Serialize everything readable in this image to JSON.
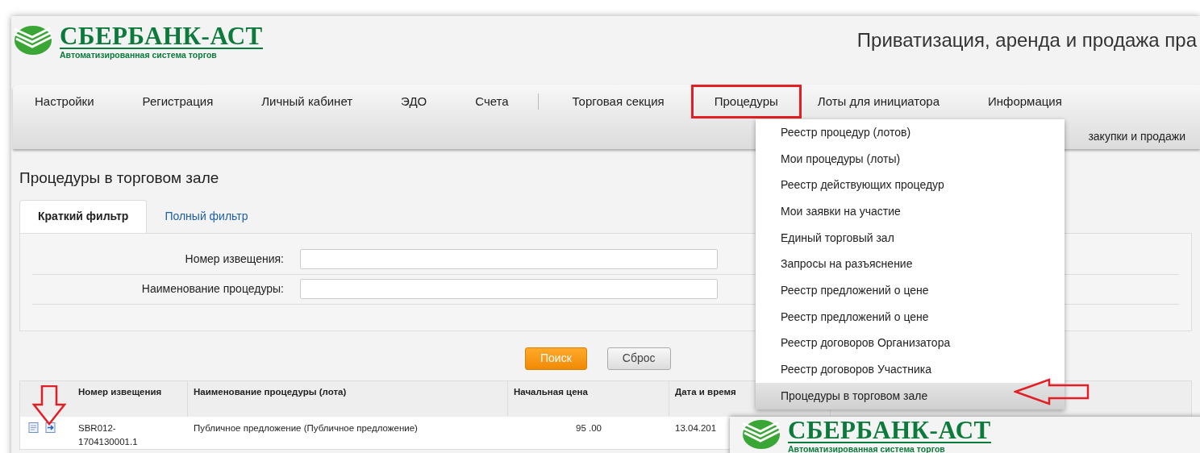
{
  "header": {
    "logo": {
      "name": "СБЕРБАНК-АСТ",
      "tagline": "Автоматизированная система торгов"
    },
    "title": "Приватизация, аренда и продажа пра"
  },
  "nav": {
    "items": [
      {
        "label": "Настройки",
        "selected": false
      },
      {
        "label": "Регистрация",
        "selected": false
      },
      {
        "label": "Личный кабинет",
        "selected": false
      },
      {
        "label": "ЭДО",
        "selected": false
      },
      {
        "label": "Счета",
        "selected": false
      },
      {
        "label": "Торговая секция",
        "selected": false
      },
      {
        "label": "Процедуры",
        "selected": true
      },
      {
        "label": "Лоты для инициатора",
        "selected": false
      },
      {
        "label": "Информация",
        "selected": false
      }
    ],
    "second_line": "закупки и продажи"
  },
  "dropdown": {
    "items": [
      {
        "label": "Реестр процедур (лотов)",
        "selected": false
      },
      {
        "label": "Мои процедуры (лоты)",
        "selected": false
      },
      {
        "label": "Реестр действующих процедур",
        "selected": false
      },
      {
        "label": "Мои заявки на участие",
        "selected": false
      },
      {
        "label": "Единый торговый зал",
        "selected": false
      },
      {
        "label": "Запросы на разъяснение",
        "selected": false
      },
      {
        "label": "Реестр предложений о цене",
        "selected": false
      },
      {
        "label": "Реестр предложений о цене",
        "selected": false
      },
      {
        "label": "Реестр договоров Организатора",
        "selected": false
      },
      {
        "label": "Реестр договоров Участника",
        "selected": false
      },
      {
        "label": "Процедуры в торговом зале",
        "selected": true
      }
    ]
  },
  "page_title": "Процедуры в торговом зале",
  "filter_tabs": [
    {
      "label": "Краткий фильтр",
      "selected": true
    },
    {
      "label": "Полный фильтр",
      "selected": false
    }
  ],
  "filter_fields": [
    {
      "label": "Номер извещения:"
    },
    {
      "label": "Наименование процедуры:"
    }
  ],
  "buttons": [
    {
      "label": "Поиск",
      "kind": "primary"
    },
    {
      "label": "Сброс",
      "kind": "secondary"
    }
  ],
  "table": {
    "columns": [
      "Номер извещения",
      "Наименование процедуры (лота)",
      "Начальная цена",
      "Дата и время"
    ],
    "rows": [
      {
        "number": "SBR012-1704130001.1",
        "name": "Публичное предложение (Публичное предложение)",
        "price": "95 .00",
        "date": "13.04.201"
      }
    ]
  },
  "overlay": {
    "logo": {
      "name": "СБЕРБАНК-АСТ",
      "tagline": "Автоматизированная система торгов"
    }
  }
}
